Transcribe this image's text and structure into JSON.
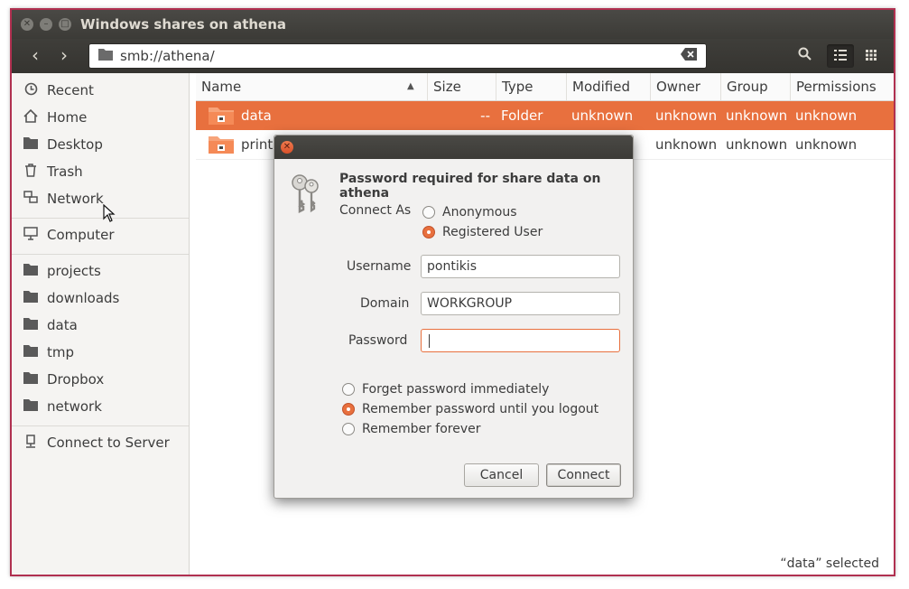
{
  "window": {
    "title": "Windows shares on athena",
    "controls": [
      "close-icon",
      "minimize-icon",
      "maximize-icon"
    ]
  },
  "toolbar": {
    "back_icon": "‹",
    "forward_icon": "›",
    "location": "smb://athena/",
    "search_icon": "search-icon",
    "list_view_icon": "list-view-icon",
    "grid_view_icon": "grid-view-icon"
  },
  "sidebar": {
    "items": [
      {
        "label": "Recent",
        "icon": "clock-icon"
      },
      {
        "label": "Home",
        "icon": "home-icon"
      },
      {
        "label": "Desktop",
        "icon": "folder-icon"
      },
      {
        "label": "Trash",
        "icon": "trash-icon"
      },
      {
        "label": "Network",
        "icon": "network-icon"
      },
      {
        "label": "Computer",
        "icon": "computer-icon"
      },
      {
        "label": "projects",
        "icon": "folder-icon"
      },
      {
        "label": "downloads",
        "icon": "folder-icon"
      },
      {
        "label": "data",
        "icon": "folder-icon"
      },
      {
        "label": "tmp",
        "icon": "folder-icon"
      },
      {
        "label": "Dropbox",
        "icon": "folder-icon"
      },
      {
        "label": "network",
        "icon": "folder-icon"
      },
      {
        "label": "Connect to Server",
        "icon": "server-icon"
      }
    ]
  },
  "files": {
    "columns": [
      "Name",
      "Size",
      "Type",
      "Modified",
      "Owner",
      "Group",
      "Permissions"
    ],
    "rows": [
      {
        "name": "data",
        "size": "--",
        "type": "Folder",
        "modified": "unknown",
        "owner": "unknown",
        "group": "unknown",
        "permissions": "unknown",
        "selected": true
      },
      {
        "name": "print$",
        "size": "",
        "type": "",
        "modified": "",
        "owner": "unknown",
        "group": "unknown",
        "permissions": "unknown",
        "selected": false
      }
    ]
  },
  "status": "“data” selected",
  "dialog": {
    "heading": "Password required for share data on athena",
    "connect_as_label": "Connect As",
    "connect_options": [
      "Anonymous",
      "Registered User"
    ],
    "connect_selected": 1,
    "username_label": "Username",
    "username_value": "pontikis",
    "domain_label": "Domain",
    "domain_value": "WORKGROUP",
    "password_label": "Password",
    "password_value": "",
    "remember_options": [
      "Forget password immediately",
      "Remember password until you logout",
      "Remember forever"
    ],
    "remember_selected": 1,
    "cancel_label": "Cancel",
    "connect_label": "Connect"
  },
  "colors": {
    "accent": "#e8703e",
    "titlebar": "#3c3b37",
    "border": "#b03050"
  }
}
